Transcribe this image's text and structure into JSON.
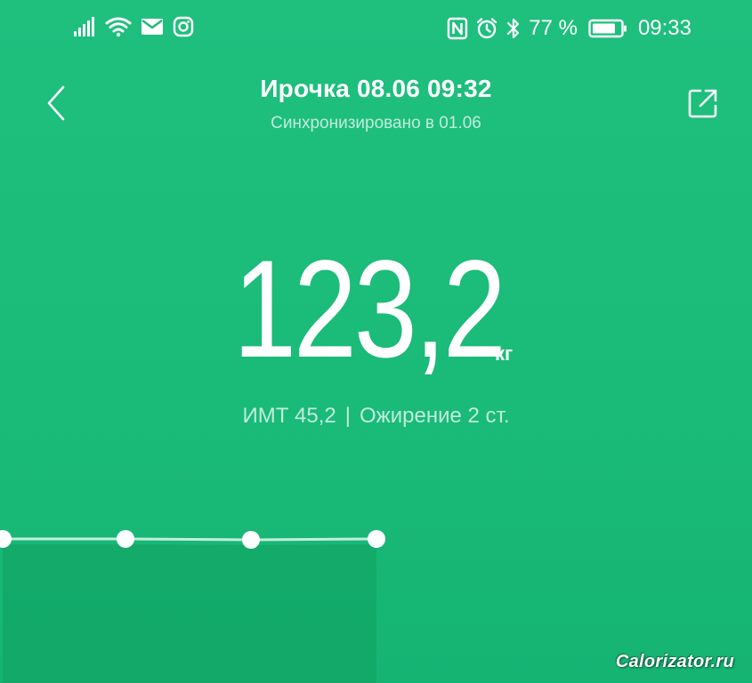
{
  "status_bar": {
    "battery_percent": "77 %",
    "time": "09:33",
    "left_icons": [
      "signal-icon",
      "wifi-icon",
      "mail-icon",
      "instagram-icon"
    ],
    "right_icons": [
      "nfc-icon",
      "alarm-icon",
      "bluetooth-icon",
      "battery-icon"
    ]
  },
  "header": {
    "title": "Ирочка 08.06 09:32",
    "subtitle": "Синхронизировано в 01.06",
    "back_icon": "chevron-left-icon",
    "share_icon": "share-icon"
  },
  "measurement": {
    "weight": "123,2",
    "unit": "кг",
    "bmi_label": "ИМТ 45,2",
    "separator": "|",
    "category": "Ожирение 2 ст."
  },
  "chart_data": {
    "type": "line",
    "x": [
      0,
      1,
      2,
      3
    ],
    "values": [
      123.2,
      123.2,
      123.2,
      123.2
    ],
    "title": "",
    "xlabel": "",
    "ylabel": "",
    "grid": false
  },
  "watermark": "Calorizator.ru",
  "colors": {
    "background": "#1aba78",
    "accent": "#ffffff"
  }
}
